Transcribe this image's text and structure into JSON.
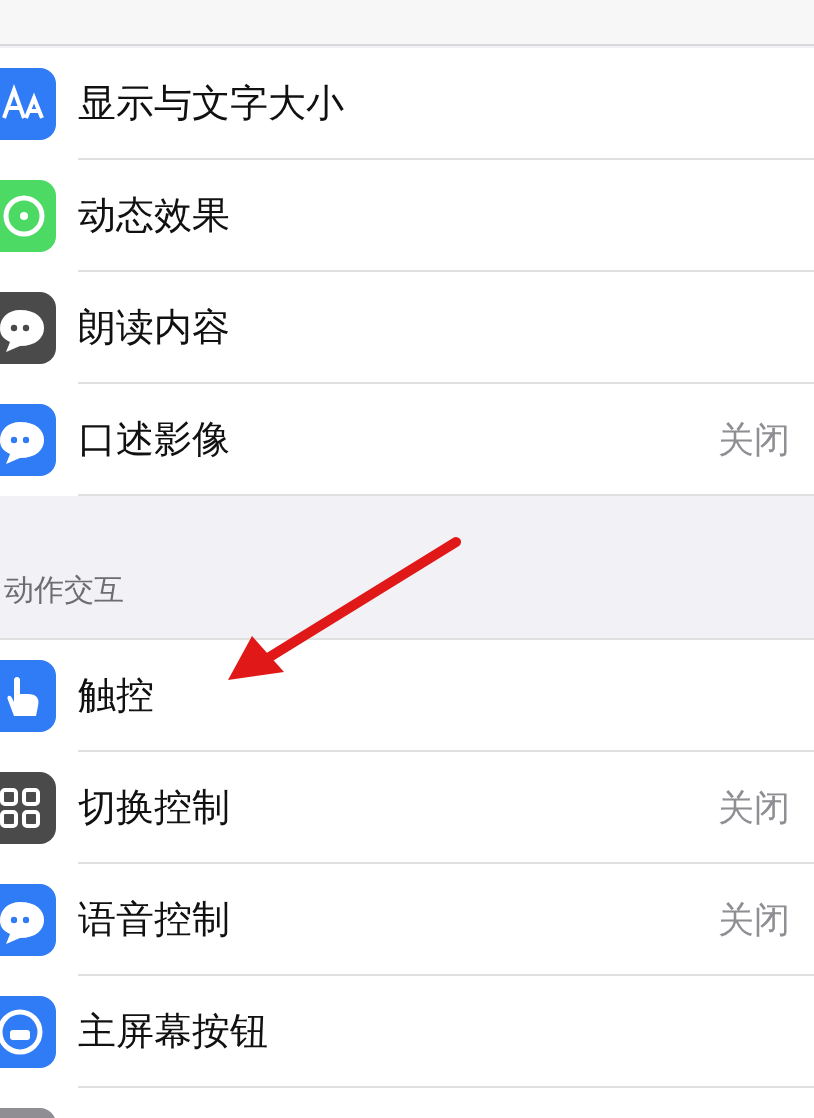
{
  "groups": [
    {
      "rows": [
        {
          "kind": "text-size",
          "label": "显示与文字大小"
        },
        {
          "kind": "motion",
          "label": "动态效果"
        },
        {
          "kind": "speech",
          "label": "朗读内容"
        },
        {
          "kind": "audio-description",
          "label": "口述影像",
          "value": "关闭"
        }
      ]
    },
    {
      "header": "动作交互",
      "rows": [
        {
          "kind": "touch",
          "label": "触控"
        },
        {
          "kind": "switch-control",
          "label": "切换控制",
          "value": "关闭"
        },
        {
          "kind": "voice-control",
          "label": "语音控制",
          "value": "关闭"
        },
        {
          "kind": "home-button",
          "label": "主屏幕按钮"
        },
        {
          "kind": "generic"
        }
      ]
    }
  ],
  "annotation": {
    "kind": "arrow"
  }
}
